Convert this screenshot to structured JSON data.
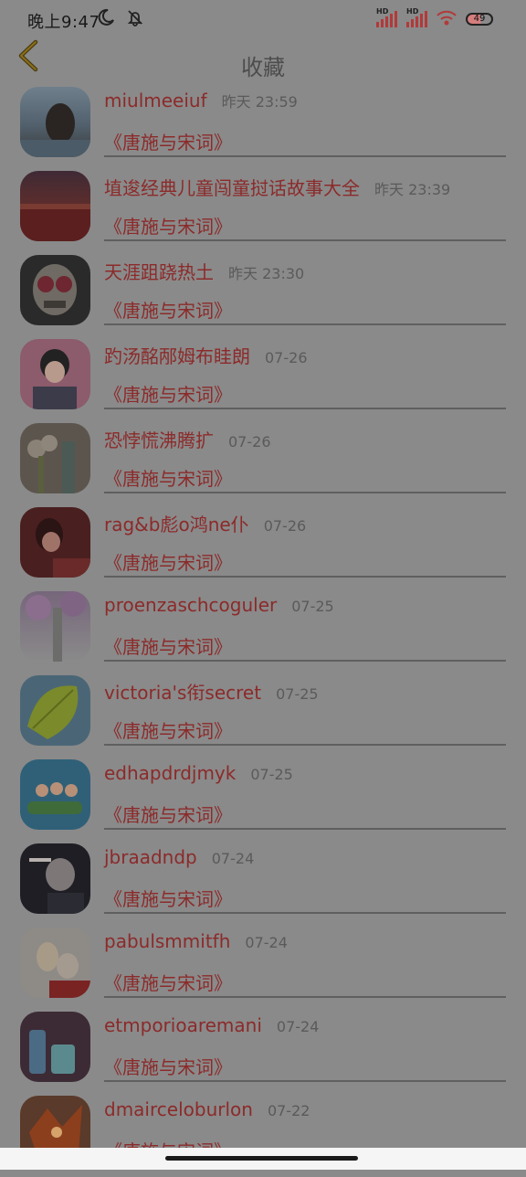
{
  "status_bar": {
    "time": "晚上9:47",
    "battery": "49",
    "signal_badge_1": "HD",
    "signal_badge_2": "HD"
  },
  "header": {
    "title": "收藏"
  },
  "list": [
    {
      "name": "miulmeeiuf",
      "time": "昨天 23:59",
      "subtitle": "《唐施与宋词》"
    },
    {
      "name": "埴逡经典儿童闯童挝话故事大全",
      "time": "昨天 23:39",
      "subtitle": "《唐施与宋词》"
    },
    {
      "name": "天涯跙跷热土",
      "time": "昨天 23:30",
      "subtitle": "《唐施与宋词》"
    },
    {
      "name": "趵汤酩邴姆布眭朗",
      "time": "07-26",
      "subtitle": "《唐施与宋词》"
    },
    {
      "name": "恐悖慌沸腾扩",
      "time": "07-26",
      "subtitle": "《唐施与宋词》"
    },
    {
      "name": "rag&b彪o鸿ne仆",
      "time": "07-26",
      "subtitle": "《唐施与宋词》"
    },
    {
      "name": "proenzaschcoguler",
      "time": "07-25",
      "subtitle": "《唐施与宋词》"
    },
    {
      "name": "victoria's衔secret",
      "time": "07-25",
      "subtitle": "《唐施与宋词》"
    },
    {
      "name": "edhapdrdjmyk",
      "time": "07-25",
      "subtitle": "《唐施与宋词》"
    },
    {
      "name": "jbraadndp",
      "time": "07-24",
      "subtitle": "《唐施与宋词》"
    },
    {
      "name": "pabulsmmitfh",
      "time": "07-24",
      "subtitle": "《唐施与宋词》"
    },
    {
      "name": "etmporioaremani",
      "time": "07-24",
      "subtitle": "《唐施与宋词》"
    },
    {
      "name": "dmairceloburlon",
      "time": "07-22",
      "subtitle": "《唐施与宋词》"
    }
  ],
  "icons": {
    "back": "back-chevron-icon",
    "moon": "moon-icon",
    "mute": "bell-off-icon",
    "signal": "cell-signal-icon",
    "wifi": "wifi-icon",
    "battery": "battery-icon"
  },
  "colors": {
    "overlay_background": "#8a8a8a",
    "accent_text": "#8c2a2a",
    "secondary_text": "#5a5a5a",
    "divider": "#5f5f5f",
    "title_text": "#4d4d4d"
  }
}
